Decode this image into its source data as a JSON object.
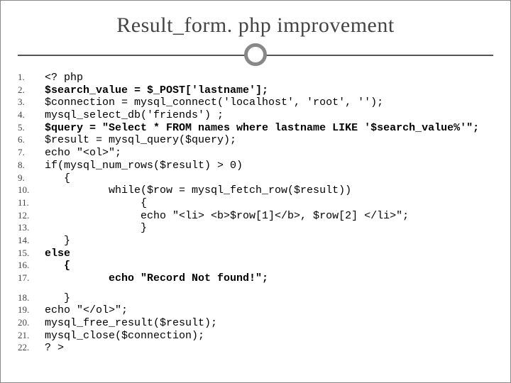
{
  "title": "Result_form. php improvement",
  "block1": [
    {
      "n": "1.",
      "t": "<? php",
      "b": false
    },
    {
      "n": "2.",
      "t": "$search_value = $_POST['lastname'];",
      "b": true
    },
    {
      "n": "3.",
      "t": "$connection = mysql_connect('localhost', 'root', '');",
      "b": false
    },
    {
      "n": "4.",
      "t": "mysql_select_db('friends') ;",
      "b": false
    },
    {
      "n": "5.",
      "t": "$query = \"Select * FROM names where lastname LIKE '$search_value%'\";",
      "b": true
    },
    {
      "n": "6.",
      "t": "$result = mysql_query($query);",
      "b": false
    },
    {
      "n": "7.",
      "t": "echo \"<ol>\";",
      "b": false
    },
    {
      "n": "8.",
      "t": "if(mysql_num_rows($result) > 0)",
      "b": false
    },
    {
      "n": "9.",
      "t": "   {",
      "b": false
    },
    {
      "n": "10.",
      "t": "          while($row = mysql_fetch_row($result))",
      "b": false
    },
    {
      "n": "11.",
      "t": "               {",
      "b": false
    },
    {
      "n": "12.",
      "t": "               echo \"<li> <b>$row[1]</b>, $row[2] </li>\";",
      "b": false
    },
    {
      "n": "13.",
      "t": "               }",
      "b": false
    },
    {
      "n": "14.",
      "t": "   }",
      "b": false
    },
    {
      "n": "15.",
      "t": "else",
      "b": true
    },
    {
      "n": "16.",
      "t": "   {",
      "b": true
    },
    {
      "n": "17.",
      "t": "          echo \"Record Not found!\";",
      "b": true
    }
  ],
  "block2": [
    {
      "n": "18.",
      "t": "   }",
      "b": false
    },
    {
      "n": "19.",
      "t": "echo \"</ol>\";",
      "b": false
    },
    {
      "n": "20.",
      "t": "mysql_free_result($result);",
      "b": false
    },
    {
      "n": "21.",
      "t": "mysql_close($connection);",
      "b": false
    },
    {
      "n": "22.",
      "t": "? >",
      "b": false
    }
  ]
}
